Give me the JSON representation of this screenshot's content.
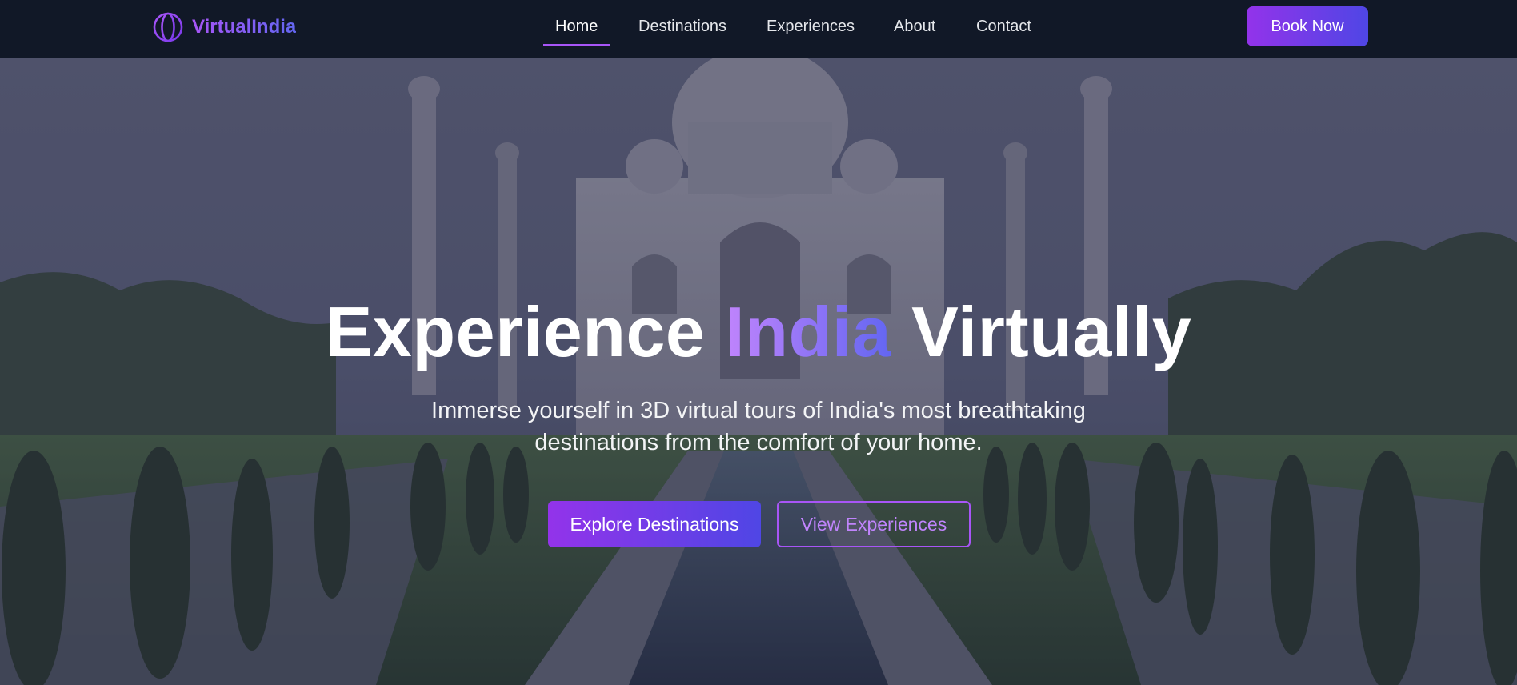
{
  "brand": {
    "name": "VirtualIndia",
    "icon": "globe-icon",
    "color_from": "#a855f7",
    "color_to": "#6366f1"
  },
  "nav": {
    "items": [
      {
        "label": "Home",
        "active": true
      },
      {
        "label": "Destinations",
        "active": false
      },
      {
        "label": "Experiences",
        "active": false
      },
      {
        "label": "About",
        "active": false
      },
      {
        "label": "Contact",
        "active": false
      }
    ],
    "cta_label": "Book Now"
  },
  "hero": {
    "title_part1": "Experience",
    "title_accent": "India",
    "title_part2": "Virtually",
    "subtitle": "Immerse yourself in 3D virtual tours of India's most breathtaking destinations from the comfort of your home.",
    "primary_button": "Explore Destinations",
    "secondary_button": "View Experiences",
    "background_image": "taj-mahal-photo"
  },
  "colors": {
    "nav_bg": "#111827",
    "accent_purple": "#9333ea",
    "accent_indigo": "#4f46e5"
  }
}
